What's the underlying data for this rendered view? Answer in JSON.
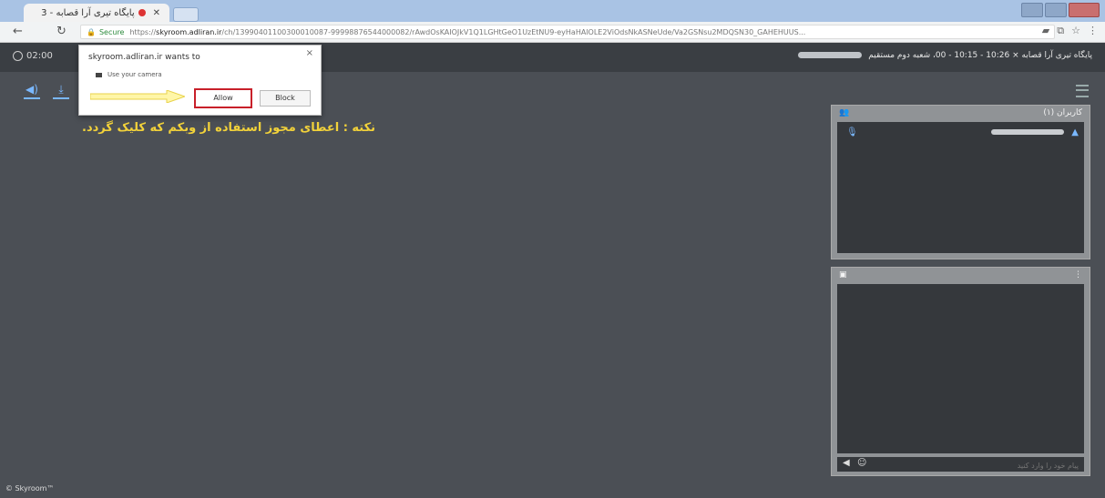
{
  "browser": {
    "tab_title": "پایگاه تیری آرا قصابه - 3",
    "address": {
      "secure_label": "Secure",
      "url_prefix": "https://",
      "domain": "skyroom.adliran.ir",
      "url_rest": "/ch/13990401100300010087-99998876544000082/rAwdOsKAIOJkV1Q1LGHtGeO1UzEtNU9-eyHaHAlOLE2ViOdsNkASNeUde/Va2GSNsu2MDQSN30_GAHEHUUS..."
    }
  },
  "app": {
    "clock": "02:00",
    "room_title": "پایگاه تیری آرا قصابه × 10:26 - 10:15 - 00، شعبه دوم مستقیم"
  },
  "note": "نکته : اعطای مجوز استفاده از وبکم که کلیک گردد.",
  "popup": {
    "title": "skyroom.adliran.ir wants to",
    "request": "Use your camera",
    "allow_label": "Allow",
    "block_label": "Block",
    "close": "×"
  },
  "users_panel": {
    "title": "کاربران (۱)"
  },
  "chat": {
    "placeholder": "پیام خود را وارد کنید"
  },
  "footer": "© Skyroom™"
}
